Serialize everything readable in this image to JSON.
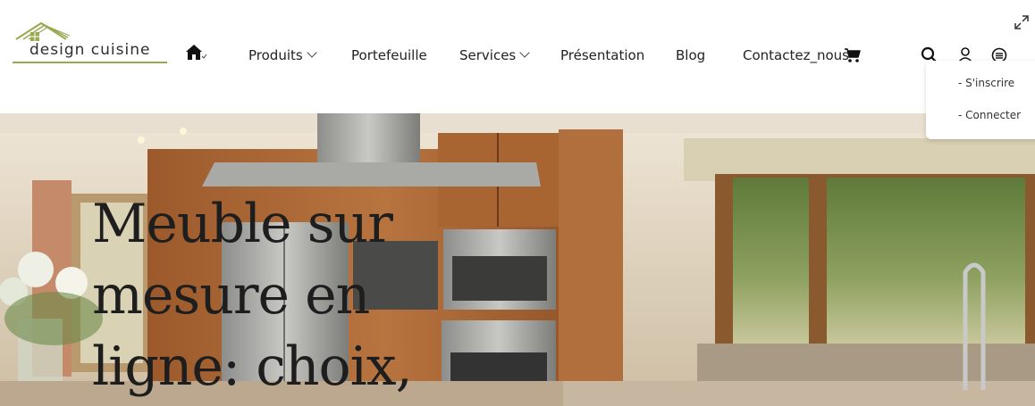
{
  "logo": {
    "text": "design cuisine",
    "accent_color": "#9aa84f"
  },
  "nav": {
    "items": [
      {
        "label": "Produits",
        "has_dropdown": true
      },
      {
        "label": "Portefeuille",
        "has_dropdown": false
      },
      {
        "label": "Services",
        "has_dropdown": true
      },
      {
        "label": "Présentation",
        "has_dropdown": false
      },
      {
        "label": "Blog",
        "has_dropdown": false
      },
      {
        "label": "Contactez_nous",
        "has_dropdown": false
      }
    ],
    "icons": [
      "home-icon",
      "cart-icon",
      "search-icon",
      "user-icon",
      "menu-icon",
      "expand-icon"
    ]
  },
  "account_menu": {
    "items": [
      {
        "label": "- S'inscrire"
      },
      {
        "label": "- Connecter"
      }
    ]
  },
  "hero": {
    "title": "Meuble sur mesure en ligne: choix,"
  }
}
